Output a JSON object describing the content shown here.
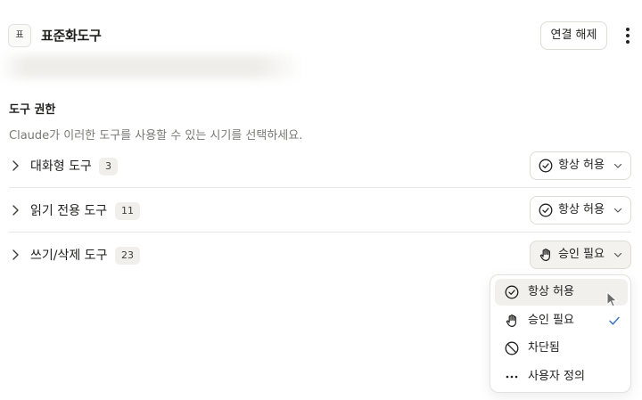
{
  "header": {
    "app_icon_text": "표",
    "title": "표준화도구",
    "disconnect_label": "연결 해제"
  },
  "section": {
    "title": "도구 권한",
    "description": "Claude가 이러한 도구를 사용할 수 있는 시기를 선택하세요."
  },
  "tool_groups": [
    {
      "label": "대화형 도구",
      "count": "3",
      "permission": "항상 허용",
      "permission_icon": "check-circle-icon"
    },
    {
      "label": "읽기 전용 도구",
      "count": "11",
      "permission": "항상 허용",
      "permission_icon": "check-circle-icon"
    },
    {
      "label": "쓰기/삭제 도구",
      "count": "23",
      "permission": "승인 필요",
      "permission_icon": "hand-icon"
    }
  ],
  "menu": {
    "items": [
      {
        "label": "항상 허용",
        "icon": "check-circle-icon",
        "hovered": true,
        "selected": false
      },
      {
        "label": "승인 필요",
        "icon": "hand-icon",
        "hovered": false,
        "selected": true
      },
      {
        "label": "차단됨",
        "icon": "blocked-icon",
        "hovered": false,
        "selected": false
      },
      {
        "label": "사용자 정의",
        "icon": "ellipsis-icon",
        "hovered": false,
        "selected": false
      }
    ]
  },
  "colors": {
    "accent": "#3f74c4",
    "hover_bg": "#f1f0ec",
    "border": "#dedcd6",
    "muted_text": "#7a7975"
  }
}
